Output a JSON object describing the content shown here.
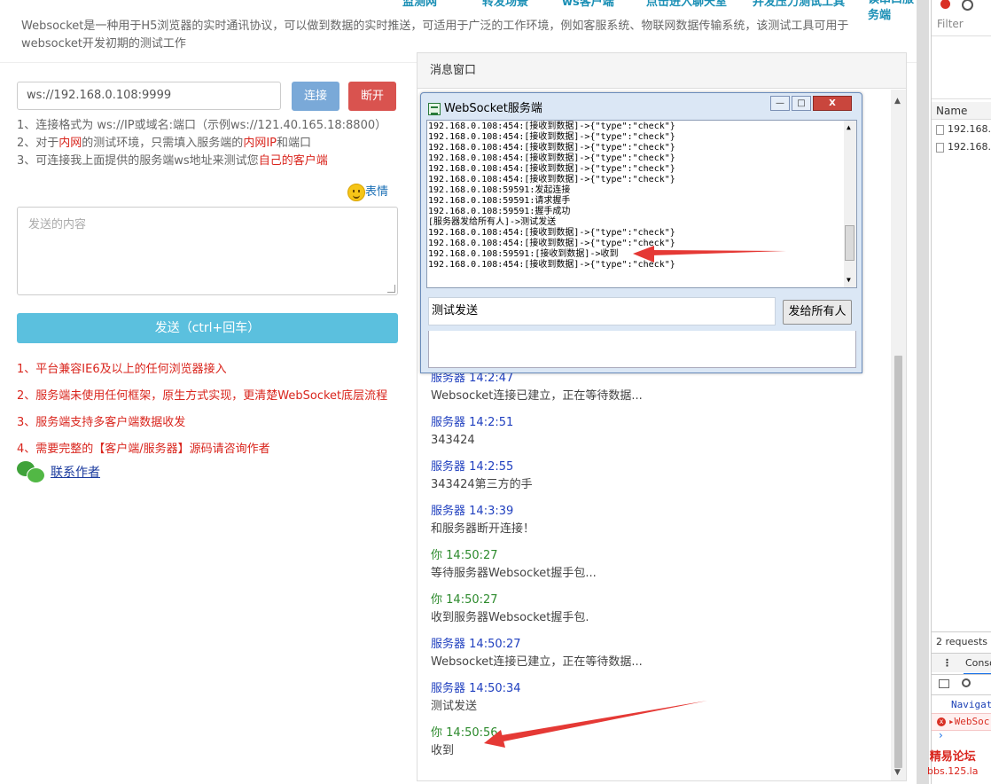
{
  "top_nav": [
    "监测网",
    "转发场景",
    "ws客户端",
    "点击进入聊天室",
    "并发压力测试工具",
    "读串口服务端"
  ],
  "intro": "Websocket是一种用于H5浏览器的实时通讯协议，可以做到数据的实时推送，可适用于广泛的工作环境，例如客服系统、物联网数据传输系统，该测试工具可用于websocket开发初期的测试工作",
  "connect": {
    "url_value": "ws://192.168.0.108:9999",
    "connect_label": "连接",
    "disconnect_label": "断开"
  },
  "tips": {
    "line1": "1、连接格式为 ws://IP或域名:端口（示例ws://121.40.165.18:8800）",
    "line2_a": "2、对于",
    "line2_b": "内网",
    "line2_c": "的测试环境，只需填入服务端的",
    "line2_d": "内网IP",
    "line2_e": "和端口",
    "line3_a": "3、可连接我上面提供的服务端ws地址来测试您",
    "line3_b": "自己的客户端"
  },
  "emoji_label": "表情",
  "send": {
    "placeholder": "发送的内容",
    "button_label": "发送（ctrl+回车）"
  },
  "features": [
    "1、平台兼容IE6及以上的任何浏览器接入",
    "2、服务端未使用任何框架，原生方式实现，更清楚WebSocket底层流程",
    "3、服务端支持多客户端数据收发",
    "4、需要完整的【客户端/服务器】源码请咨询作者"
  ],
  "contact_label": "联系作者",
  "message_window": {
    "title": "消息窗口",
    "messages": [
      {
        "sender": "服务器",
        "time": "14:2:47",
        "text": "Websocket连接已建立，正在等待数据...",
        "kind": "server"
      },
      {
        "sender": "服务器",
        "time": "14:2:51",
        "text": "343424",
        "kind": "server"
      },
      {
        "sender": "服务器",
        "time": "14:2:55",
        "text": "343424第三方的手",
        "kind": "server"
      },
      {
        "sender": "服务器",
        "time": "14:3:39",
        "text": "和服务器断开连接！",
        "kind": "server"
      },
      {
        "sender": "你",
        "time": "14:50:27",
        "text": "等待服务器Websocket握手包...",
        "kind": "you"
      },
      {
        "sender": "你",
        "time": "14:50:27",
        "text": "收到服务器Websocket握手包.",
        "kind": "you"
      },
      {
        "sender": "服务器",
        "time": "14:50:27",
        "text": "Websocket连接已建立，正在等待数据...",
        "kind": "server"
      },
      {
        "sender": "服务器",
        "time": "14:50:34",
        "text": "测试发送",
        "kind": "server"
      },
      {
        "sender": "你",
        "time": "14:50:56",
        "text": "收到",
        "kind": "you"
      }
    ]
  },
  "server_window": {
    "title": "WebSocket服务端",
    "minimize": "—",
    "maximize": "□",
    "close": "X",
    "log_lines": [
      "192.168.0.108:454:[接收到数据]->{\"type\":\"check\"}",
      "192.168.0.108:454:[接收到数据]->{\"type\":\"check\"}",
      "192.168.0.108:454:[接收到数据]->{\"type\":\"check\"}",
      "192.168.0.108:454:[接收到数据]->{\"type\":\"check\"}",
      "192.168.0.108:454:[接收到数据]->{\"type\":\"check\"}",
      "192.168.0.108:454:[接收到数据]->{\"type\":\"check\"}",
      "192.168.0.108:59591:发起连接",
      "192.168.0.108:59591:请求握手",
      "192.168.0.108:59591:握手成功",
      "[服务器发给所有人]->测试发送",
      "192.168.0.108:454:[接收到数据]->{\"type\":\"check\"}",
      "192.168.0.108:454:[接收到数据]->{\"type\":\"check\"}",
      "192.168.0.108:59591:[接收到数据]->收到",
      "192.168.0.108:454:[接收到数据]->{\"type\":\"check\"}"
    ],
    "input_value": "测试发送",
    "broadcast_label": "发给所有人"
  },
  "devtools": {
    "filter_label": "Filter",
    "name_header": "Name",
    "rows": [
      "192.168.0",
      "192.168.0"
    ],
    "status": "2 requests",
    "console_tab": "Conso",
    "log_line1": "Navigat",
    "log_line2": "▸WebSoc",
    "prompt": "›"
  },
  "watermark": {
    "line1": "精易论坛",
    "line2": "bbs.125.la"
  },
  "colors": {
    "accent_red": "#d9251d",
    "connect_blue": "#7aa9d8",
    "disconnect_red": "#d9534f",
    "send_cyan": "#5bc0de",
    "server_blue": "#1f3fbf",
    "you_green": "#2c8a2c"
  }
}
